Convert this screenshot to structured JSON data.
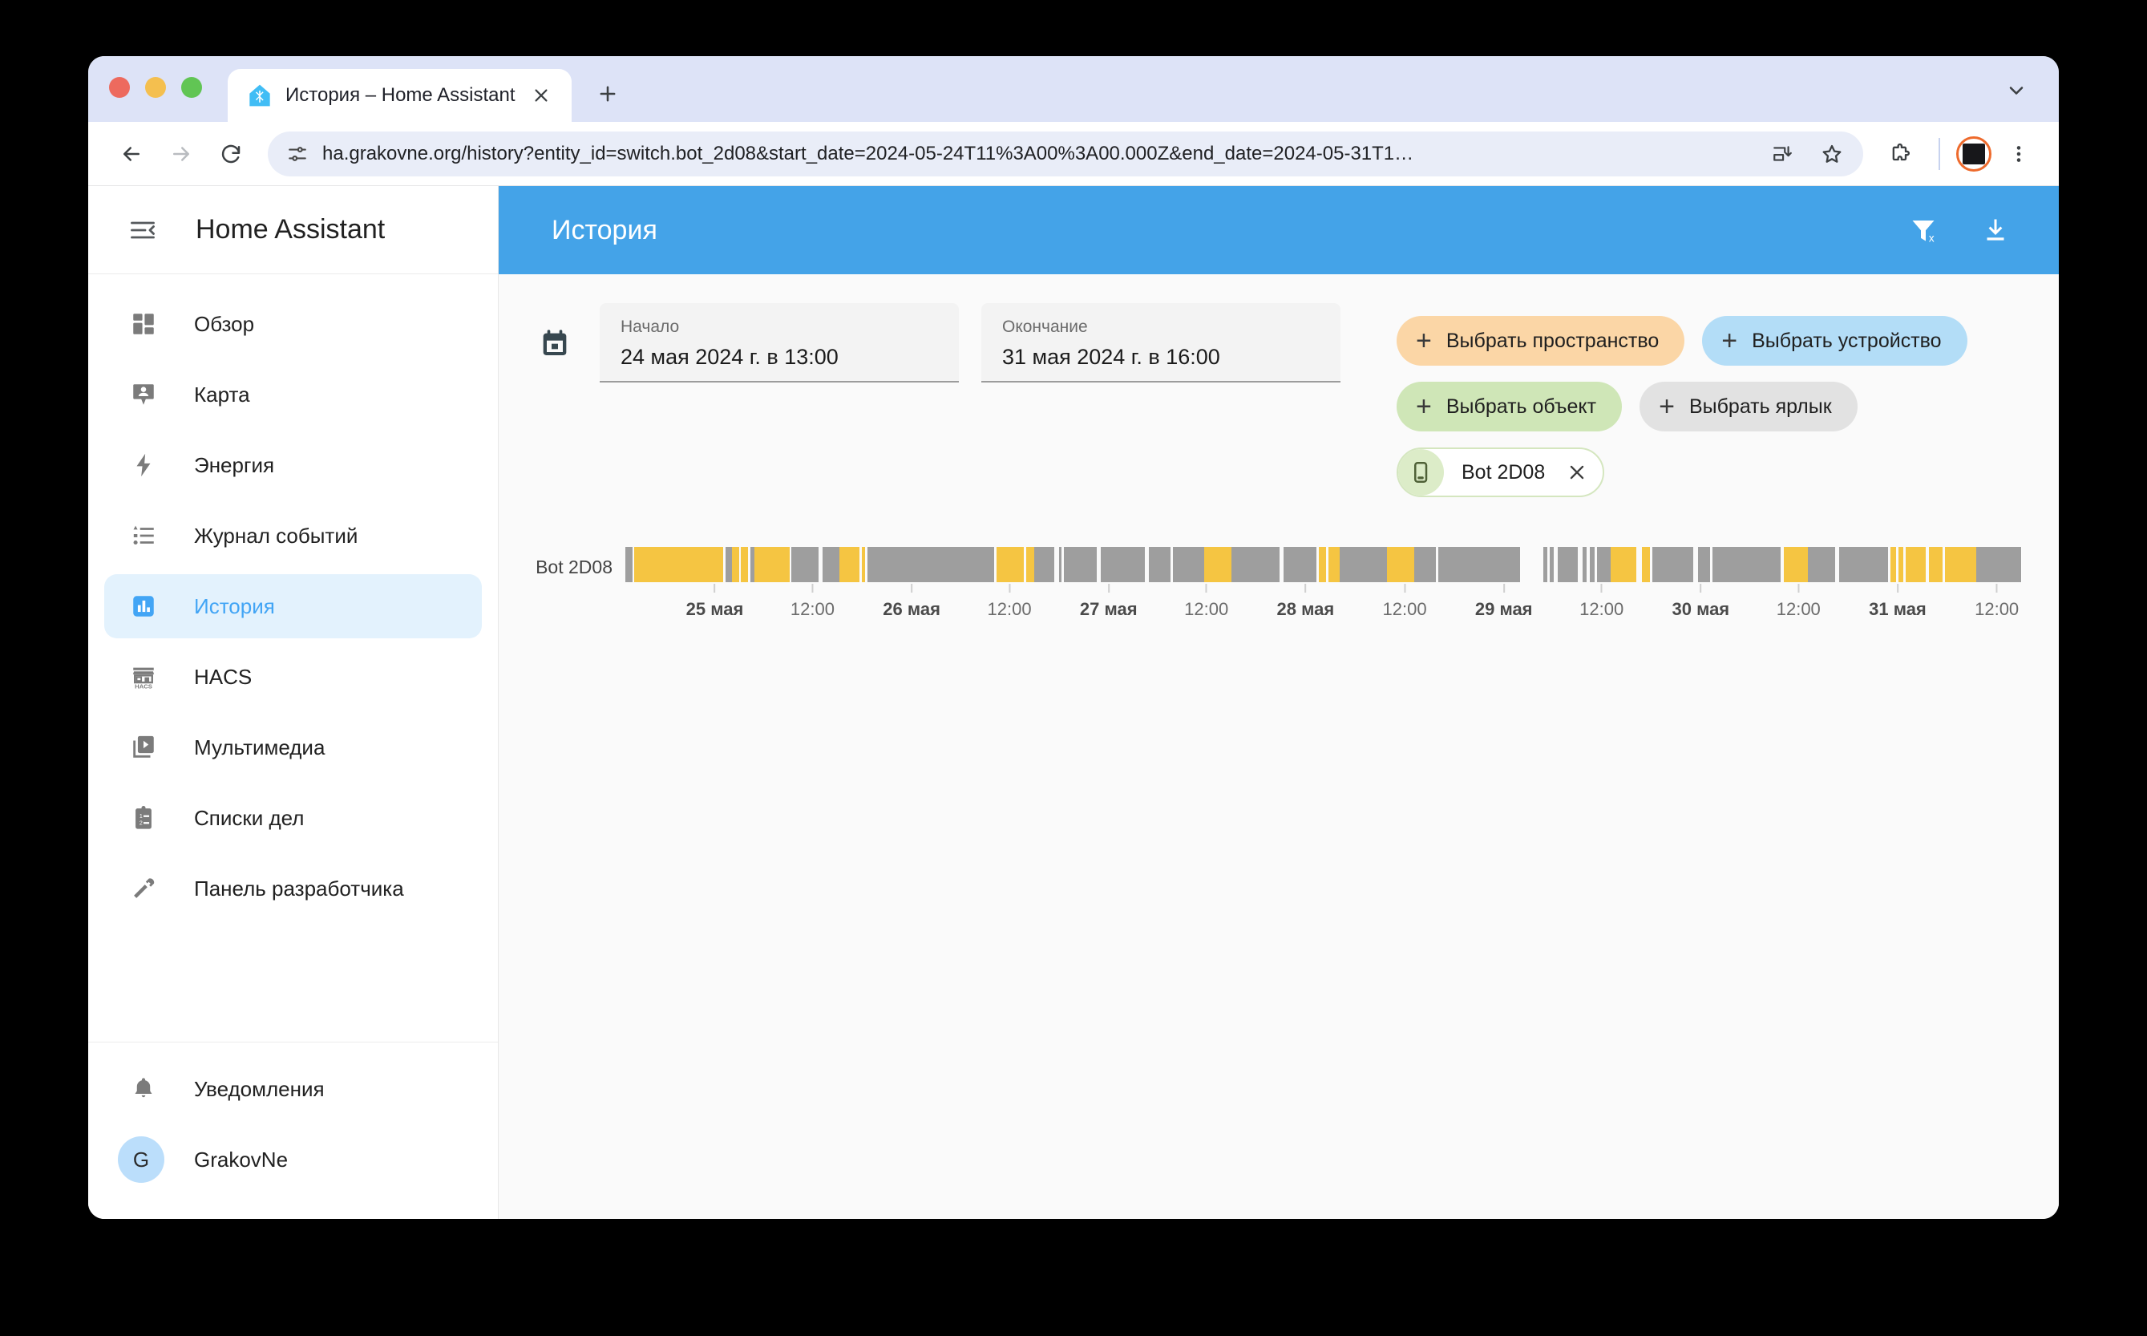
{
  "browser": {
    "tab": {
      "title": "История – Home Assistant",
      "favicon": "home-assistant-logo"
    },
    "new_tab_label": "+",
    "omnibox": {
      "url": "ha.grakovne.org/history?entity_id=switch.bot_2d08&start_date=2024-05-24T11%3A00%3A00.000Z&end_date=2024-05-31T1…",
      "site_info_icon": "tune-icon"
    },
    "actions": {
      "back": "back-icon",
      "forward": "forward-icon",
      "reload": "reload-icon",
      "cast": "cast-icon",
      "bookmark": "star-icon",
      "extensions": "puzzle-icon",
      "profile": "profile-avatar",
      "menu": "three-dot-menu-icon",
      "tabstrip_menu": "chevron-down-icon"
    }
  },
  "sidebar": {
    "title": "Home Assistant",
    "toggle_icon": "menu-collapse-icon",
    "items": [
      {
        "label": "Обзор",
        "icon": "dashboard-icon",
        "active": false
      },
      {
        "label": "Карта",
        "icon": "map-marker-account-icon",
        "active": false
      },
      {
        "label": "Энергия",
        "icon": "lightning-bolt-icon",
        "active": false
      },
      {
        "label": "Журнал событий",
        "icon": "format-list-bulleted-icon",
        "active": false
      },
      {
        "label": "История",
        "icon": "chart-box-icon",
        "active": true
      },
      {
        "label": "HACS",
        "icon": "hacs-storefront-icon",
        "active": false
      },
      {
        "label": "Мультимедиа",
        "icon": "play-box-multiple-icon",
        "active": false
      },
      {
        "label": "Списки дел",
        "icon": "clipboard-list-icon",
        "active": false
      },
      {
        "label": "Панель разработчика",
        "icon": "hammer-wrench-icon",
        "active": false
      }
    ],
    "footer": [
      {
        "label": "Уведомления",
        "icon": "bell-icon"
      },
      {
        "label": "GrakovNe",
        "icon": "avatar",
        "avatar_letter": "G"
      }
    ]
  },
  "appbar": {
    "title": "История",
    "accent_color": "#44a3e8",
    "actions": [
      {
        "name": "filter-remove-icon",
        "label": "Сбросить фильтры"
      },
      {
        "name": "download-icon",
        "label": "Скачать данные"
      }
    ]
  },
  "filters": {
    "calendar_icon": "calendar-icon",
    "start": {
      "label": "Начало",
      "value": "24 мая 2024 г. в 13:00"
    },
    "end": {
      "label": "Окончание",
      "value": "31 мая 2024 г. в 16:00"
    },
    "chips": [
      {
        "label": "Выбрать пространство",
        "color": "orange"
      },
      {
        "label": "Выбрать устройство",
        "color": "blue"
      },
      {
        "label": "Выбрать объект",
        "color": "green"
      },
      {
        "label": "Выбрать ярлык",
        "color": "gray"
      }
    ],
    "selected_entities": [
      {
        "label": "Bot 2D08",
        "icon": "tablet-icon",
        "remove_icon": "close-icon"
      }
    ]
  },
  "chart_data": {
    "type": "timeline",
    "title": "",
    "row_label": "Bot 2D08",
    "xlabel": "",
    "ylabel": "",
    "grid": false,
    "legend_position": "none",
    "x_range": [
      "2024-05-24 13:00",
      "2024-05-31 16:00"
    ],
    "tick_labels": [
      {
        "text": "25 мая",
        "major": true,
        "pos_pct": 6.4
      },
      {
        "text": "12:00",
        "major": false,
        "pos_pct": 13.4
      },
      {
        "text": "26 мая",
        "major": true,
        "pos_pct": 20.5
      },
      {
        "text": "12:00",
        "major": false,
        "pos_pct": 27.5
      },
      {
        "text": "27 мая",
        "major": true,
        "pos_pct": 34.6
      },
      {
        "text": "12:00",
        "major": false,
        "pos_pct": 41.6
      },
      {
        "text": "28 мая",
        "major": true,
        "pos_pct": 48.7
      },
      {
        "text": "12:00",
        "major": false,
        "pos_pct": 55.8
      },
      {
        "text": "29 мая",
        "major": true,
        "pos_pct": 62.9
      },
      {
        "text": "12:00",
        "major": false,
        "pos_pct": 69.9
      },
      {
        "text": "30 мая",
        "major": true,
        "pos_pct": 77.0
      },
      {
        "text": "12:00",
        "major": false,
        "pos_pct": 84.0
      },
      {
        "text": "31 мая",
        "major": true,
        "pos_pct": 91.1
      },
      {
        "text": "12:00",
        "major": false,
        "pos_pct": 98.2
      }
    ],
    "state_colors": {
      "on": "#f5c542",
      "off": "#9e9e9e",
      "unavailable": "#fafafa"
    },
    "segments": [
      {
        "state": "off",
        "width_pct": 0.5
      },
      {
        "state": "unavailable",
        "width_pct": 0.15
      },
      {
        "state": "on",
        "width_pct": 6.5
      },
      {
        "state": "unavailable",
        "width_pct": 0.2
      },
      {
        "state": "off",
        "width_pct": 0.45
      },
      {
        "state": "on",
        "width_pct": 0.55
      },
      {
        "state": "unavailable",
        "width_pct": 0.15
      },
      {
        "state": "on",
        "width_pct": 0.5
      },
      {
        "state": "unavailable",
        "width_pct": 0.15
      },
      {
        "state": "off",
        "width_pct": 0.3
      },
      {
        "state": "on",
        "width_pct": 2.6
      },
      {
        "state": "unavailable",
        "width_pct": 0.15
      },
      {
        "state": "off",
        "width_pct": 2.0
      },
      {
        "state": "unavailable",
        "width_pct": 0.3
      },
      {
        "state": "off",
        "width_pct": 1.2
      },
      {
        "state": "on",
        "width_pct": 1.5
      },
      {
        "state": "unavailable",
        "width_pct": 0.15
      },
      {
        "state": "on",
        "width_pct": 0.25
      },
      {
        "state": "unavailable",
        "width_pct": 0.15
      },
      {
        "state": "off",
        "width_pct": 9.3
      },
      {
        "state": "unavailable",
        "width_pct": 0.2
      },
      {
        "state": "on",
        "width_pct": 2.0
      },
      {
        "state": "unavailable",
        "width_pct": 0.15
      },
      {
        "state": "on",
        "width_pct": 0.6
      },
      {
        "state": "off",
        "width_pct": 1.5
      },
      {
        "state": "unavailable",
        "width_pct": 0.3
      },
      {
        "state": "off",
        "width_pct": 0.2
      },
      {
        "state": "unavailable",
        "width_pct": 0.2
      },
      {
        "state": "off",
        "width_pct": 2.4
      },
      {
        "state": "unavailable",
        "width_pct": 0.3
      },
      {
        "state": "off",
        "width_pct": 3.2
      },
      {
        "state": "unavailable",
        "width_pct": 0.3
      },
      {
        "state": "off",
        "width_pct": 1.6
      },
      {
        "state": "unavailable",
        "width_pct": 0.2
      },
      {
        "state": "off",
        "width_pct": 2.3
      },
      {
        "state": "on",
        "width_pct": 2.0
      },
      {
        "state": "off",
        "width_pct": 3.5
      },
      {
        "state": "unavailable",
        "width_pct": 0.3
      },
      {
        "state": "off",
        "width_pct": 2.4
      },
      {
        "state": "unavailable",
        "width_pct": 0.2
      },
      {
        "state": "on",
        "width_pct": 0.5
      },
      {
        "state": "unavailable",
        "width_pct": 0.2
      },
      {
        "state": "on",
        "width_pct": 0.8
      },
      {
        "state": "off",
        "width_pct": 3.5
      },
      {
        "state": "on",
        "width_pct": 2.0
      },
      {
        "state": "off",
        "width_pct": 1.6
      },
      {
        "state": "unavailable",
        "width_pct": 0.15
      },
      {
        "state": "off",
        "width_pct": 6.0
      },
      {
        "state": "unavailable",
        "width_pct": 1.7
      },
      {
        "state": "off",
        "width_pct": 0.3
      },
      {
        "state": "unavailable",
        "width_pct": 0.2
      },
      {
        "state": "off",
        "width_pct": 0.3
      },
      {
        "state": "unavailable",
        "width_pct": 0.25
      },
      {
        "state": "off",
        "width_pct": 1.5
      },
      {
        "state": "unavailable",
        "width_pct": 0.35
      },
      {
        "state": "off",
        "width_pct": 0.3
      },
      {
        "state": "unavailable",
        "width_pct": 0.25
      },
      {
        "state": "off",
        "width_pct": 0.3
      },
      {
        "state": "unavailable",
        "width_pct": 0.2
      },
      {
        "state": "off",
        "width_pct": 1.0
      },
      {
        "state": "on",
        "width_pct": 1.9
      },
      {
        "state": "unavailable",
        "width_pct": 0.4
      },
      {
        "state": "on",
        "width_pct": 0.6
      },
      {
        "state": "unavailable",
        "width_pct": 0.15
      },
      {
        "state": "off",
        "width_pct": 3.0
      },
      {
        "state": "unavailable",
        "width_pct": 0.35
      },
      {
        "state": "off",
        "width_pct": 0.9
      },
      {
        "state": "unavailable",
        "width_pct": 0.2
      },
      {
        "state": "off",
        "width_pct": 5.0
      },
      {
        "state": "unavailable",
        "width_pct": 0.2
      },
      {
        "state": "on",
        "width_pct": 1.8
      },
      {
        "state": "off",
        "width_pct": 2.0
      },
      {
        "state": "unavailable",
        "width_pct": 0.25
      },
      {
        "state": "off",
        "width_pct": 3.6
      },
      {
        "state": "unavailable",
        "width_pct": 0.2
      },
      {
        "state": "on",
        "width_pct": 0.4
      },
      {
        "state": "unavailable",
        "width_pct": 0.2
      },
      {
        "state": "on",
        "width_pct": 0.3
      },
      {
        "state": "unavailable",
        "width_pct": 0.2
      },
      {
        "state": "on",
        "width_pct": 1.5
      },
      {
        "state": "unavailable",
        "width_pct": 0.2
      },
      {
        "state": "on",
        "width_pct": 1.0
      },
      {
        "state": "unavailable",
        "width_pct": 0.2
      },
      {
        "state": "on",
        "width_pct": 2.3
      },
      {
        "state": "off",
        "width_pct": 3.3
      }
    ]
  }
}
